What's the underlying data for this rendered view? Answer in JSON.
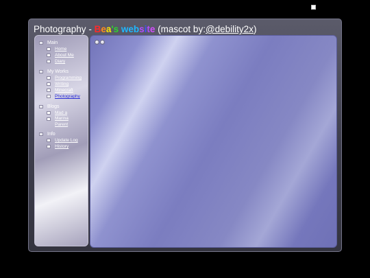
{
  "title": {
    "prefix": "Photography",
    "separator": " - ",
    "site_name_letters": [
      {
        "char": "B",
        "color": "#ff2a2a"
      },
      {
        "char": "e",
        "color": "#ff8c1a"
      },
      {
        "char": "a",
        "color": "#ffe600"
      },
      {
        "char": "'",
        "color": "#2ed42e"
      },
      {
        "char": "s",
        "color": "#2ed42e"
      },
      {
        "char": " ",
        "color": "#ffffff"
      },
      {
        "char": "w",
        "color": "#1fb7ff"
      },
      {
        "char": "e",
        "color": "#1fb7ff"
      },
      {
        "char": "b",
        "color": "#1fb7ff"
      },
      {
        "char": "s",
        "color": "#b04dff"
      },
      {
        "char": "i",
        "color": "#3d52ff"
      },
      {
        "char": "t",
        "color": "#b04dff"
      },
      {
        "char": "e",
        "color": "#d44dff"
      }
    ],
    "mascot_prefix": " (mascot by:",
    "mascot_link": "@debility2x",
    "mascot_suffix": ")"
  },
  "sidebar": {
    "groups": [
      {
        "label": "Main",
        "items": [
          {
            "label": "Home"
          },
          {
            "label": "About Me"
          },
          {
            "label": "Diary"
          }
        ]
      },
      {
        "label": "My Works",
        "items": [
          {
            "label": "Programming"
          },
          {
            "label": "Writing"
          },
          {
            "label": "Minecraft"
          },
          {
            "label": "Photography",
            "active": true
          }
        ]
      },
      {
        "label": "Blogs",
        "items": [
          {
            "label": "Mad a"
          },
          {
            "label": "Marina"
          },
          {
            "label": "Parent"
          }
        ]
      },
      {
        "label": "Info",
        "items": [
          {
            "label": "Update Log"
          },
          {
            "label": "History"
          }
        ]
      }
    ]
  },
  "content": {
    "toolbar": [
      "minimize-icon",
      "maximize-icon"
    ]
  },
  "colors": {
    "background": "#000000",
    "content_accent": "#7274b9",
    "active_link": "#2a2cd6"
  }
}
